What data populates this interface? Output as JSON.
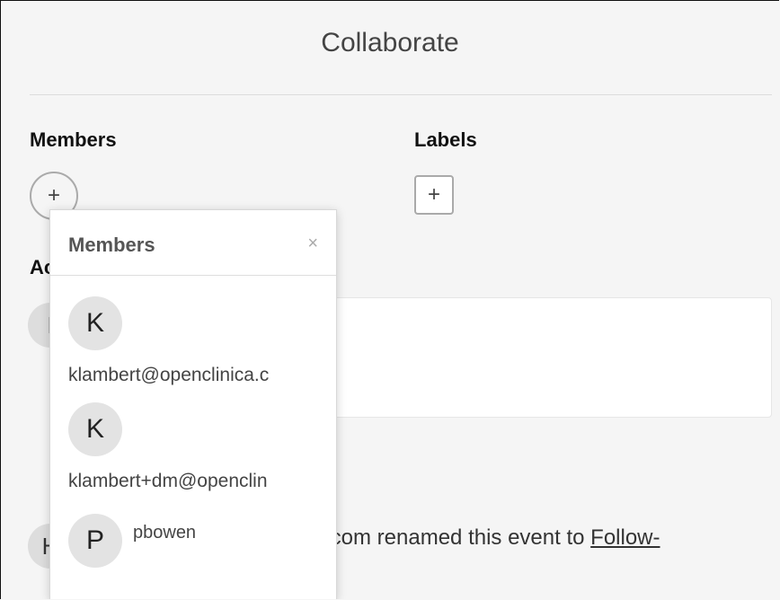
{
  "header": {
    "title": "Collaborate"
  },
  "members": {
    "label": "Members",
    "add_symbol": "+"
  },
  "labels": {
    "label": "Labels",
    "add_symbol": "+"
  },
  "activity": {
    "label_fragment": "Ac",
    "history_prefix": ".com renamed this event to ",
    "history_link": "Follow-",
    "bg_avatar_initials": [
      "I",
      "H"
    ]
  },
  "popup": {
    "title": "Members",
    "close_symbol": "×",
    "items": [
      {
        "initial": "K",
        "text": "klambert@openclinica.c"
      },
      {
        "initial": "K",
        "text": "klambert+dm@openclin"
      },
      {
        "initial": "P",
        "text": "pbowen"
      }
    ]
  }
}
